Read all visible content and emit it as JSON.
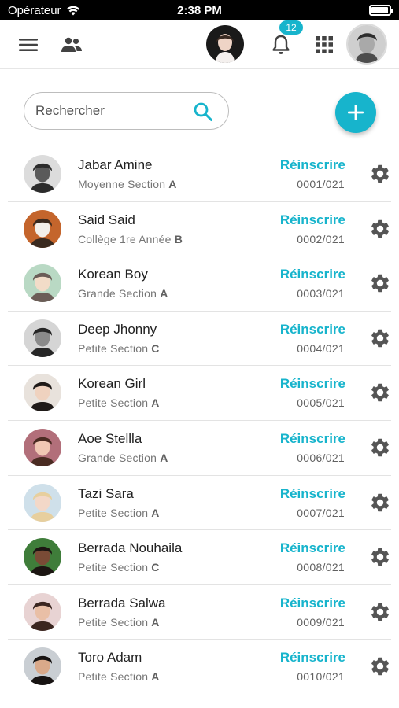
{
  "status_bar": {
    "carrier": "Opérateur",
    "time": "2:38 PM",
    "battery_level": 0.95
  },
  "app_bar": {
    "icons": [
      "menu-icon",
      "group-icon",
      "bell-icon",
      "apps-grid-icon"
    ],
    "notification_count": "12"
  },
  "search": {
    "placeholder": "Rechercher",
    "value": ""
  },
  "colors": {
    "accent": "#17b4cc",
    "text": "#212121",
    "muted": "#757575",
    "icon": "#555555"
  },
  "students": [
    {
      "name": "Jabar Amine",
      "level": "Moyenne Section",
      "group": "A",
      "action": "Réinscrire",
      "code": "0001/021",
      "avatar_tones": [
        "#dcdcdc",
        "#5a5a5a",
        "#2b2b2b"
      ]
    },
    {
      "name": "Said Said",
      "level": "Collège 1re Année",
      "group": "B",
      "action": "Réinscrire",
      "code": "0002/021",
      "avatar_tones": [
        "#c4652c",
        "#f2efea",
        "#3a2a1f"
      ]
    },
    {
      "name": "Korean Boy",
      "level": "Grande Section",
      "group": "A",
      "action": "Réinscrire",
      "code": "0003/021",
      "avatar_tones": [
        "#b9d9c4",
        "#f2dcc8",
        "#6b5d57"
      ]
    },
    {
      "name": "Deep Jhonny",
      "level": "Petite Section",
      "group": "C",
      "action": "Réinscrire",
      "code": "0004/021",
      "avatar_tones": [
        "#d5d5d5",
        "#8a8a8a",
        "#262626"
      ]
    },
    {
      "name": "Korean Girl",
      "level": "Petite Section",
      "group": "A",
      "action": "Réinscrire",
      "code": "0005/021",
      "avatar_tones": [
        "#e8e2dc",
        "#efd2bf",
        "#1f1a18"
      ]
    },
    {
      "name": "Aoe Stellla",
      "level": "Grande Section",
      "group": "A",
      "action": "Réinscrire",
      "code": "0006/021",
      "avatar_tones": [
        "#b26f7a",
        "#f0c7b4",
        "#4a2b22"
      ]
    },
    {
      "name": "Tazi Sara",
      "level": "Petite Section",
      "group": "A",
      "action": "Réinscrire",
      "code": "0007/021",
      "avatar_tones": [
        "#cfe0ea",
        "#f3d8c8",
        "#e7cf9e"
      ]
    },
    {
      "name": "Berrada Nouhaila",
      "level": "Petite Section",
      "group": "C",
      "action": "Réinscrire",
      "code": "0008/021",
      "avatar_tones": [
        "#3f7d3a",
        "#7a4b36",
        "#1c1512"
      ]
    },
    {
      "name": "Berrada Salwa",
      "level": "Petite Section",
      "group": "A",
      "action": "Réinscrire",
      "code": "0009/021",
      "avatar_tones": [
        "#e8d3d3",
        "#e9bfa6",
        "#3b2620"
      ]
    },
    {
      "name": "Toro Adam",
      "level": "Petite Section",
      "group": "A",
      "action": "Réinscrire",
      "code": "0010/021",
      "avatar_tones": [
        "#c9ced3",
        "#d9a98a",
        "#171312"
      ]
    }
  ]
}
